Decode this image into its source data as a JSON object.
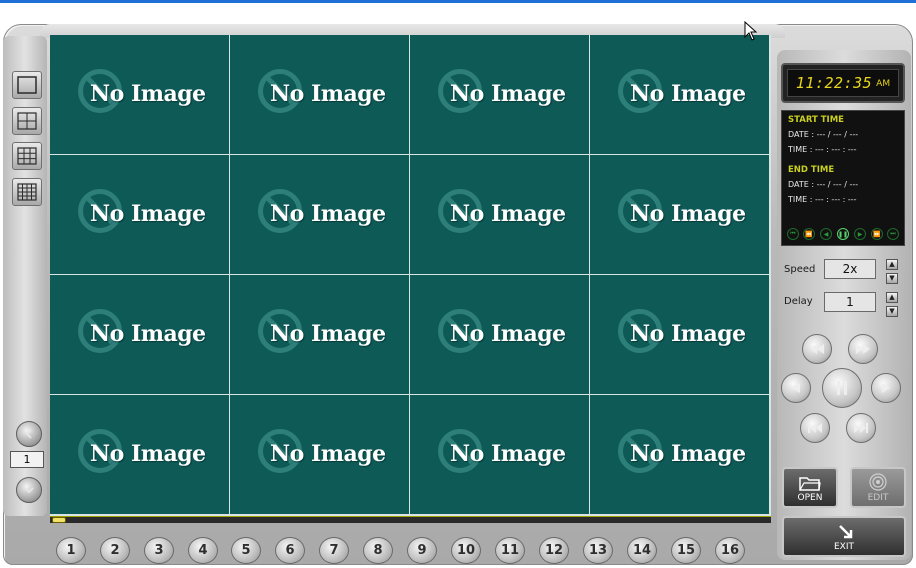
{
  "layout_buttons": [
    {
      "name": "layout-1x1-button",
      "grid": 1
    },
    {
      "name": "layout-2x2-button",
      "grid": 2
    },
    {
      "name": "layout-3x3-button",
      "grid": 3
    },
    {
      "name": "layout-4x4-button",
      "grid": 4
    }
  ],
  "page": {
    "number": "1"
  },
  "cells": {
    "label": "No Image"
  },
  "progress": {
    "fraction": 0.0
  },
  "channels": [
    "1",
    "2",
    "3",
    "4",
    "5",
    "6",
    "7",
    "8",
    "9",
    "10",
    "11",
    "12",
    "13",
    "14",
    "15",
    "16"
  ],
  "clock": {
    "time": "11:22:35",
    "ampm": "AM"
  },
  "info": {
    "start_title": "START TIME",
    "start_date": "DATE : --- / --- / ---",
    "start_time": "TIME : --- : --- : ---",
    "end_title": "END TIME",
    "end_date": "DATE : --- / --- / ---",
    "end_time": "TIME : --- : --- : ---"
  },
  "speed": {
    "label": "Speed",
    "value": "2x"
  },
  "delay": {
    "label": "Delay",
    "value": "1"
  },
  "buttons": {
    "open": "OPEN",
    "edit": "EDIT",
    "exit": "EXIT"
  },
  "colors": {
    "cell_bg": "#0e5a56",
    "accent_yellow": "#d6d200",
    "clock_text": "#e7d51b",
    "info_header": "#c8cf1f"
  }
}
